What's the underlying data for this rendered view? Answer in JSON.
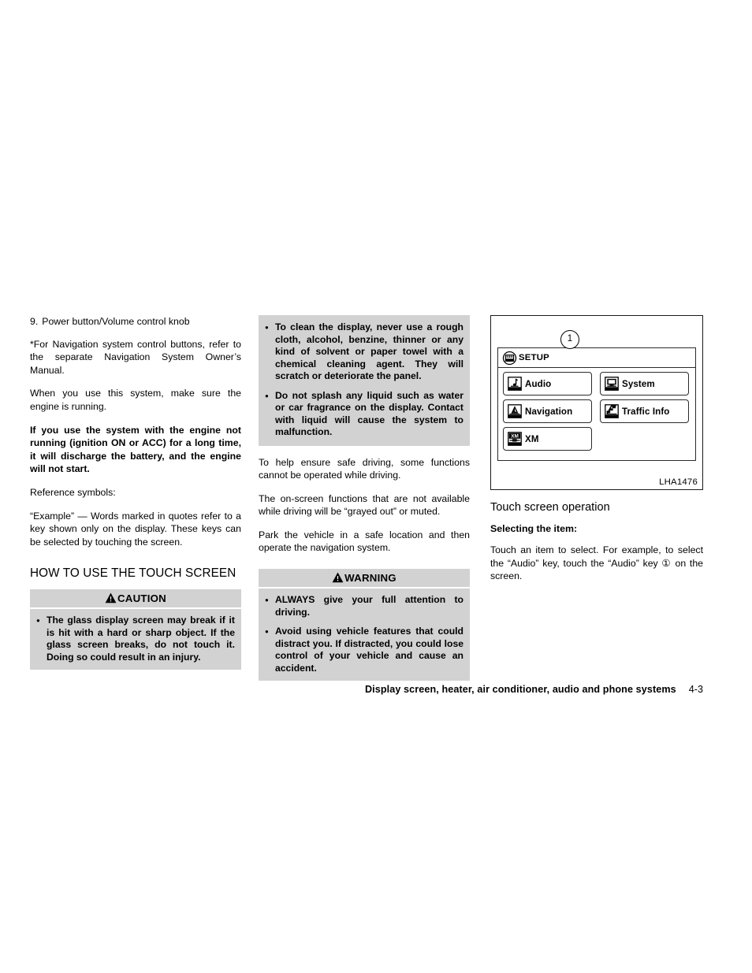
{
  "column1": {
    "list_item": {
      "number": "9.",
      "text": "Power button/Volume control knob"
    },
    "paragraph_nav_note": "*For Navigation system control buttons, refer to the separate Navigation System Owner’s Manual.",
    "paragraph_engine": "When you use this system, make sure the engine is running.",
    "paragraph_battery_bold": "If you use the system with the engine not running (ignition ON or ACC) for a long time, it will discharge the battery, and the engine will not start.",
    "paragraph_reference_symbols": "Reference symbols:",
    "paragraph_example": "“Example” — Words marked in quotes refer to a key shown only on the display. These keys can be selected by touching the screen.",
    "section_title": "HOW TO USE THE TOUCH SCREEN",
    "caution": {
      "heading": "CAUTION",
      "icon": "warning-triangle-icon",
      "items": [
        "The glass display screen may break if it is hit with a hard or sharp object. If the glass screen breaks, do not touch it. Doing so could result in an injury."
      ]
    }
  },
  "column2": {
    "caution_continued": {
      "items": [
        "To clean the display, never use a rough cloth, alcohol, benzine, thinner or any kind of solvent or paper towel with a chemical cleaning agent. They will scratch or deteriorate the panel.",
        "Do not splash any liquid such as water or car fragrance on the display. Contact with liquid will cause the system to malfunction."
      ]
    },
    "paragraph_safe_driving": "To help ensure safe driving, some functions cannot be operated while driving.",
    "paragraph_grayed_out": "The on-screen functions that are not available while driving will be “grayed out” or muted.",
    "paragraph_park": "Park the vehicle in a safe location and then operate the navigation system.",
    "warning": {
      "heading": "WARNING",
      "icon": "warning-triangle-icon",
      "items": [
        "ALWAYS give your full attention to driving.",
        "Avoid using vehicle features that could distract you. If distracted, you could lose control of your vehicle and cause an accident."
      ]
    }
  },
  "column3": {
    "figure": {
      "id_label": "LHA1476",
      "callout_number": "1",
      "screen": {
        "header": {
          "icon": "setup-icon",
          "label": "SETUP"
        },
        "keys": [
          {
            "icon": "audio-note-icon",
            "label": "Audio"
          },
          {
            "icon": "system-monitor-icon",
            "label": "System"
          },
          {
            "icon": "navigation-arrow-icon",
            "label": "Navigation"
          },
          {
            "icon": "traffic-info-icon",
            "label": "Traffic Info"
          },
          {
            "icon": "xm-icon",
            "label": "XM"
          }
        ]
      }
    },
    "figure_title": "Touch screen operation",
    "sub_title": "Selecting the item:",
    "paragraph_touch": "Touch an item to select. For example, to select the “Audio” key, touch the “Audio” key ① on the screen."
  },
  "footer": {
    "title": "Display screen, heater, air conditioner, audio and phone systems",
    "page_number": "4-3"
  },
  "colors": {
    "alert_background": "#d2d2d2",
    "text": "#000000",
    "page_background": "#ffffff"
  }
}
